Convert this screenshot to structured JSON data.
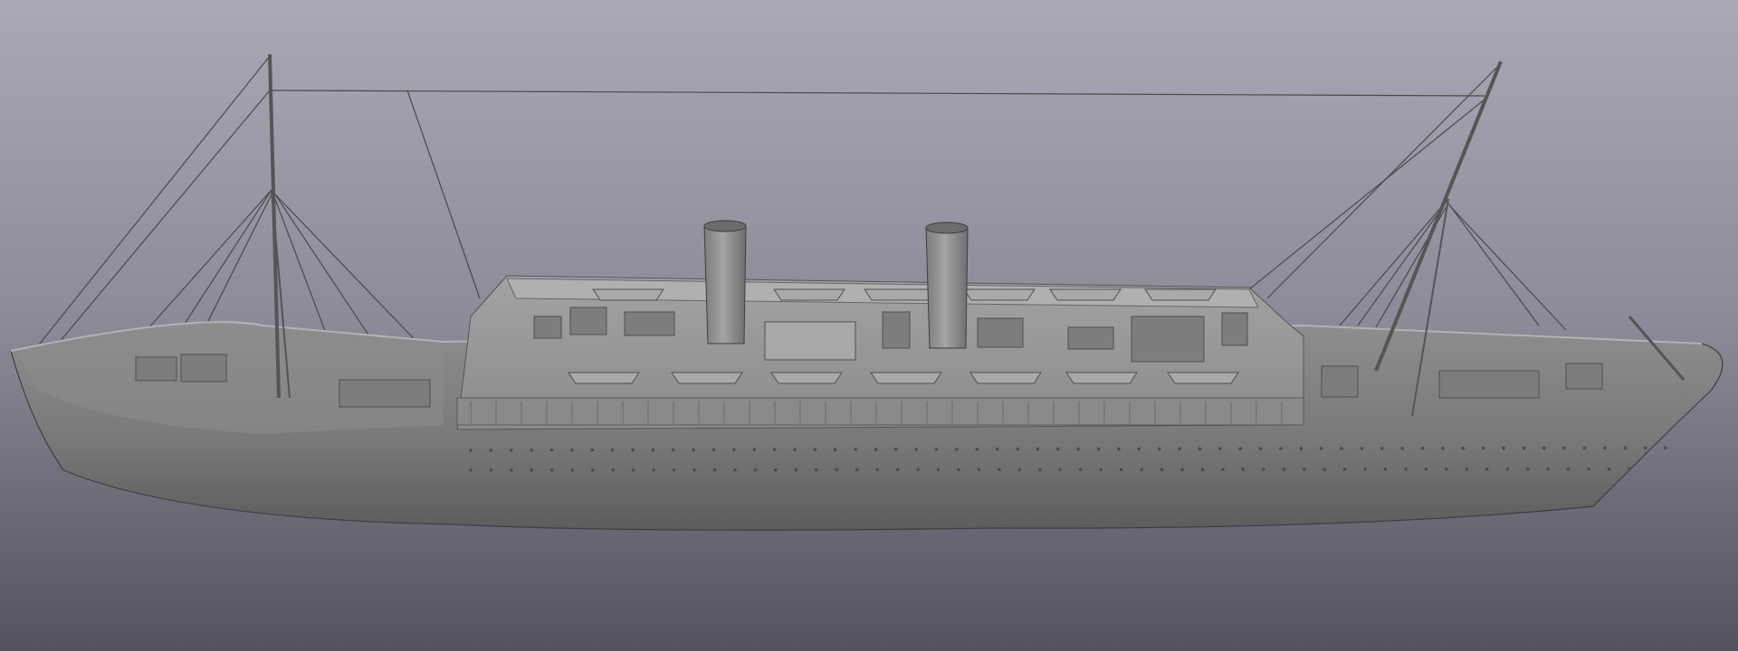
{
  "viewport": {
    "background_top": "#a9a9b6",
    "background_bottom": "#53525f"
  },
  "model": {
    "hull_light": "#8e8e8e",
    "hull_dark": "#5c5c5c",
    "deck_color": "#9a9a9a",
    "superstructure_color": "#a1a1a1",
    "funnel_color": "#8f8f8f",
    "rigging_color": "#4a4a4a",
    "funnel_count": 2,
    "mast_count": 2,
    "lifeboat_rows": 2
  }
}
